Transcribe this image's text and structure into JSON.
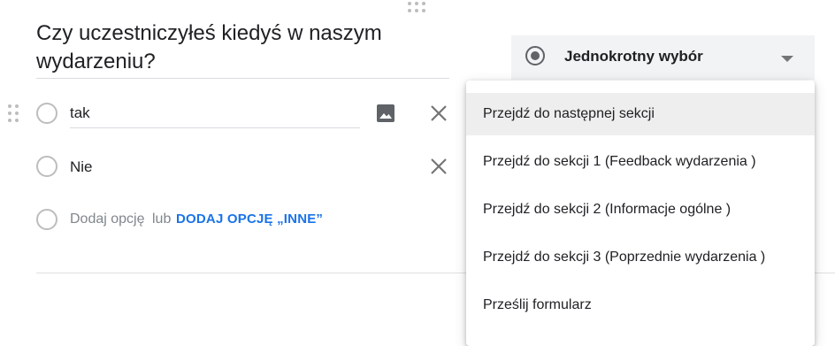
{
  "question": {
    "title": "Czy uczestniczyłeś kiedyś w naszym wydarzeniu?"
  },
  "question_type": {
    "label": "Jednokrotny wybór",
    "icon": "radio-button-icon"
  },
  "options": [
    {
      "label": "tak"
    },
    {
      "label": "Nie"
    }
  ],
  "add_option": {
    "placeholder": "Dodaj opcję",
    "or_text": "lub",
    "add_other_label": "DODAJ OPCJĘ „INNE”"
  },
  "go_to_menu": {
    "items": [
      {
        "label": "Przejdź do następnej sekcji",
        "selected": true
      },
      {
        "label": "Przejdź do sekcji 1 (Feedback wydarzenia )",
        "selected": false
      },
      {
        "label": "Przejdź do sekcji 2 (Informacje ogólne )",
        "selected": false
      },
      {
        "label": "Przejdź do sekcji 3 (Poprzednie wydarzenia )",
        "selected": false
      },
      {
        "label": "Prześlij formularz",
        "selected": false
      }
    ]
  },
  "colors": {
    "accent_blue": "#1a73e8",
    "text_primary": "#202124",
    "text_secondary": "#80868b",
    "select_bg": "#f1f3f4",
    "menu_highlight": "#eeeeee"
  }
}
